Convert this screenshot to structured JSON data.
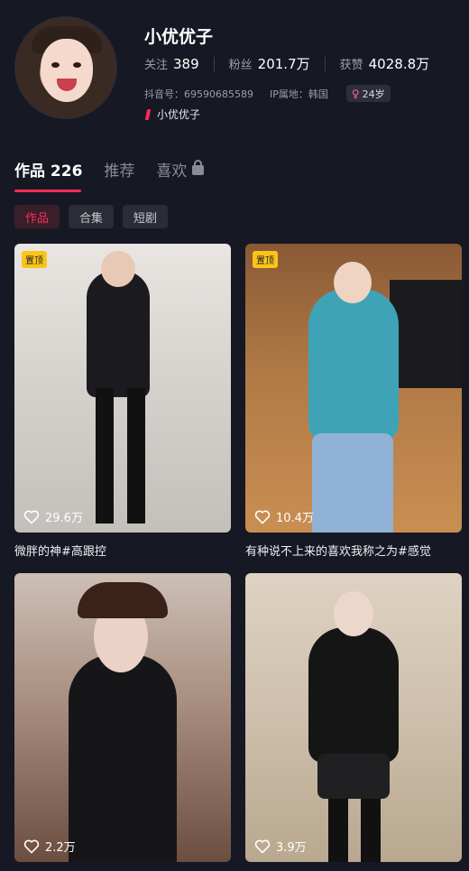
{
  "profile": {
    "name": "小优优子",
    "stats": [
      {
        "label": "关注",
        "value": "389"
      },
      {
        "label": "粉丝",
        "value": "201.7万"
      },
      {
        "label": "获赞",
        "value": "4028.8万"
      }
    ],
    "douyin_id": "抖音号：69590685589",
    "ip_location": "IP属地：韩国",
    "age": "24岁",
    "tagline": "小优优子"
  },
  "tabs": [
    {
      "label": "作品 226",
      "active": true
    },
    {
      "label": "推荐",
      "active": false
    },
    {
      "label": "喜欢",
      "active": false,
      "locked": true
    }
  ],
  "chips": [
    {
      "label": "作品",
      "active": true
    },
    {
      "label": "合集",
      "active": false
    },
    {
      "label": "短剧",
      "active": false
    }
  ],
  "videos": [
    {
      "pinned": true,
      "pin_label": "置顶",
      "likes": "29.6万",
      "caption": "微胖的神#高跟控"
    },
    {
      "pinned": true,
      "pin_label": "置顶",
      "likes": "10.4万",
      "caption": "有种说不上来的喜欢我称之为#感觉"
    },
    {
      "pinned": false,
      "likes": "2.2万",
      "caption": ""
    },
    {
      "pinned": false,
      "likes": "3.9万",
      "caption": ""
    }
  ],
  "colors": {
    "accent": "#fe2c55",
    "background": "#161823",
    "pin": "#fcc419"
  }
}
